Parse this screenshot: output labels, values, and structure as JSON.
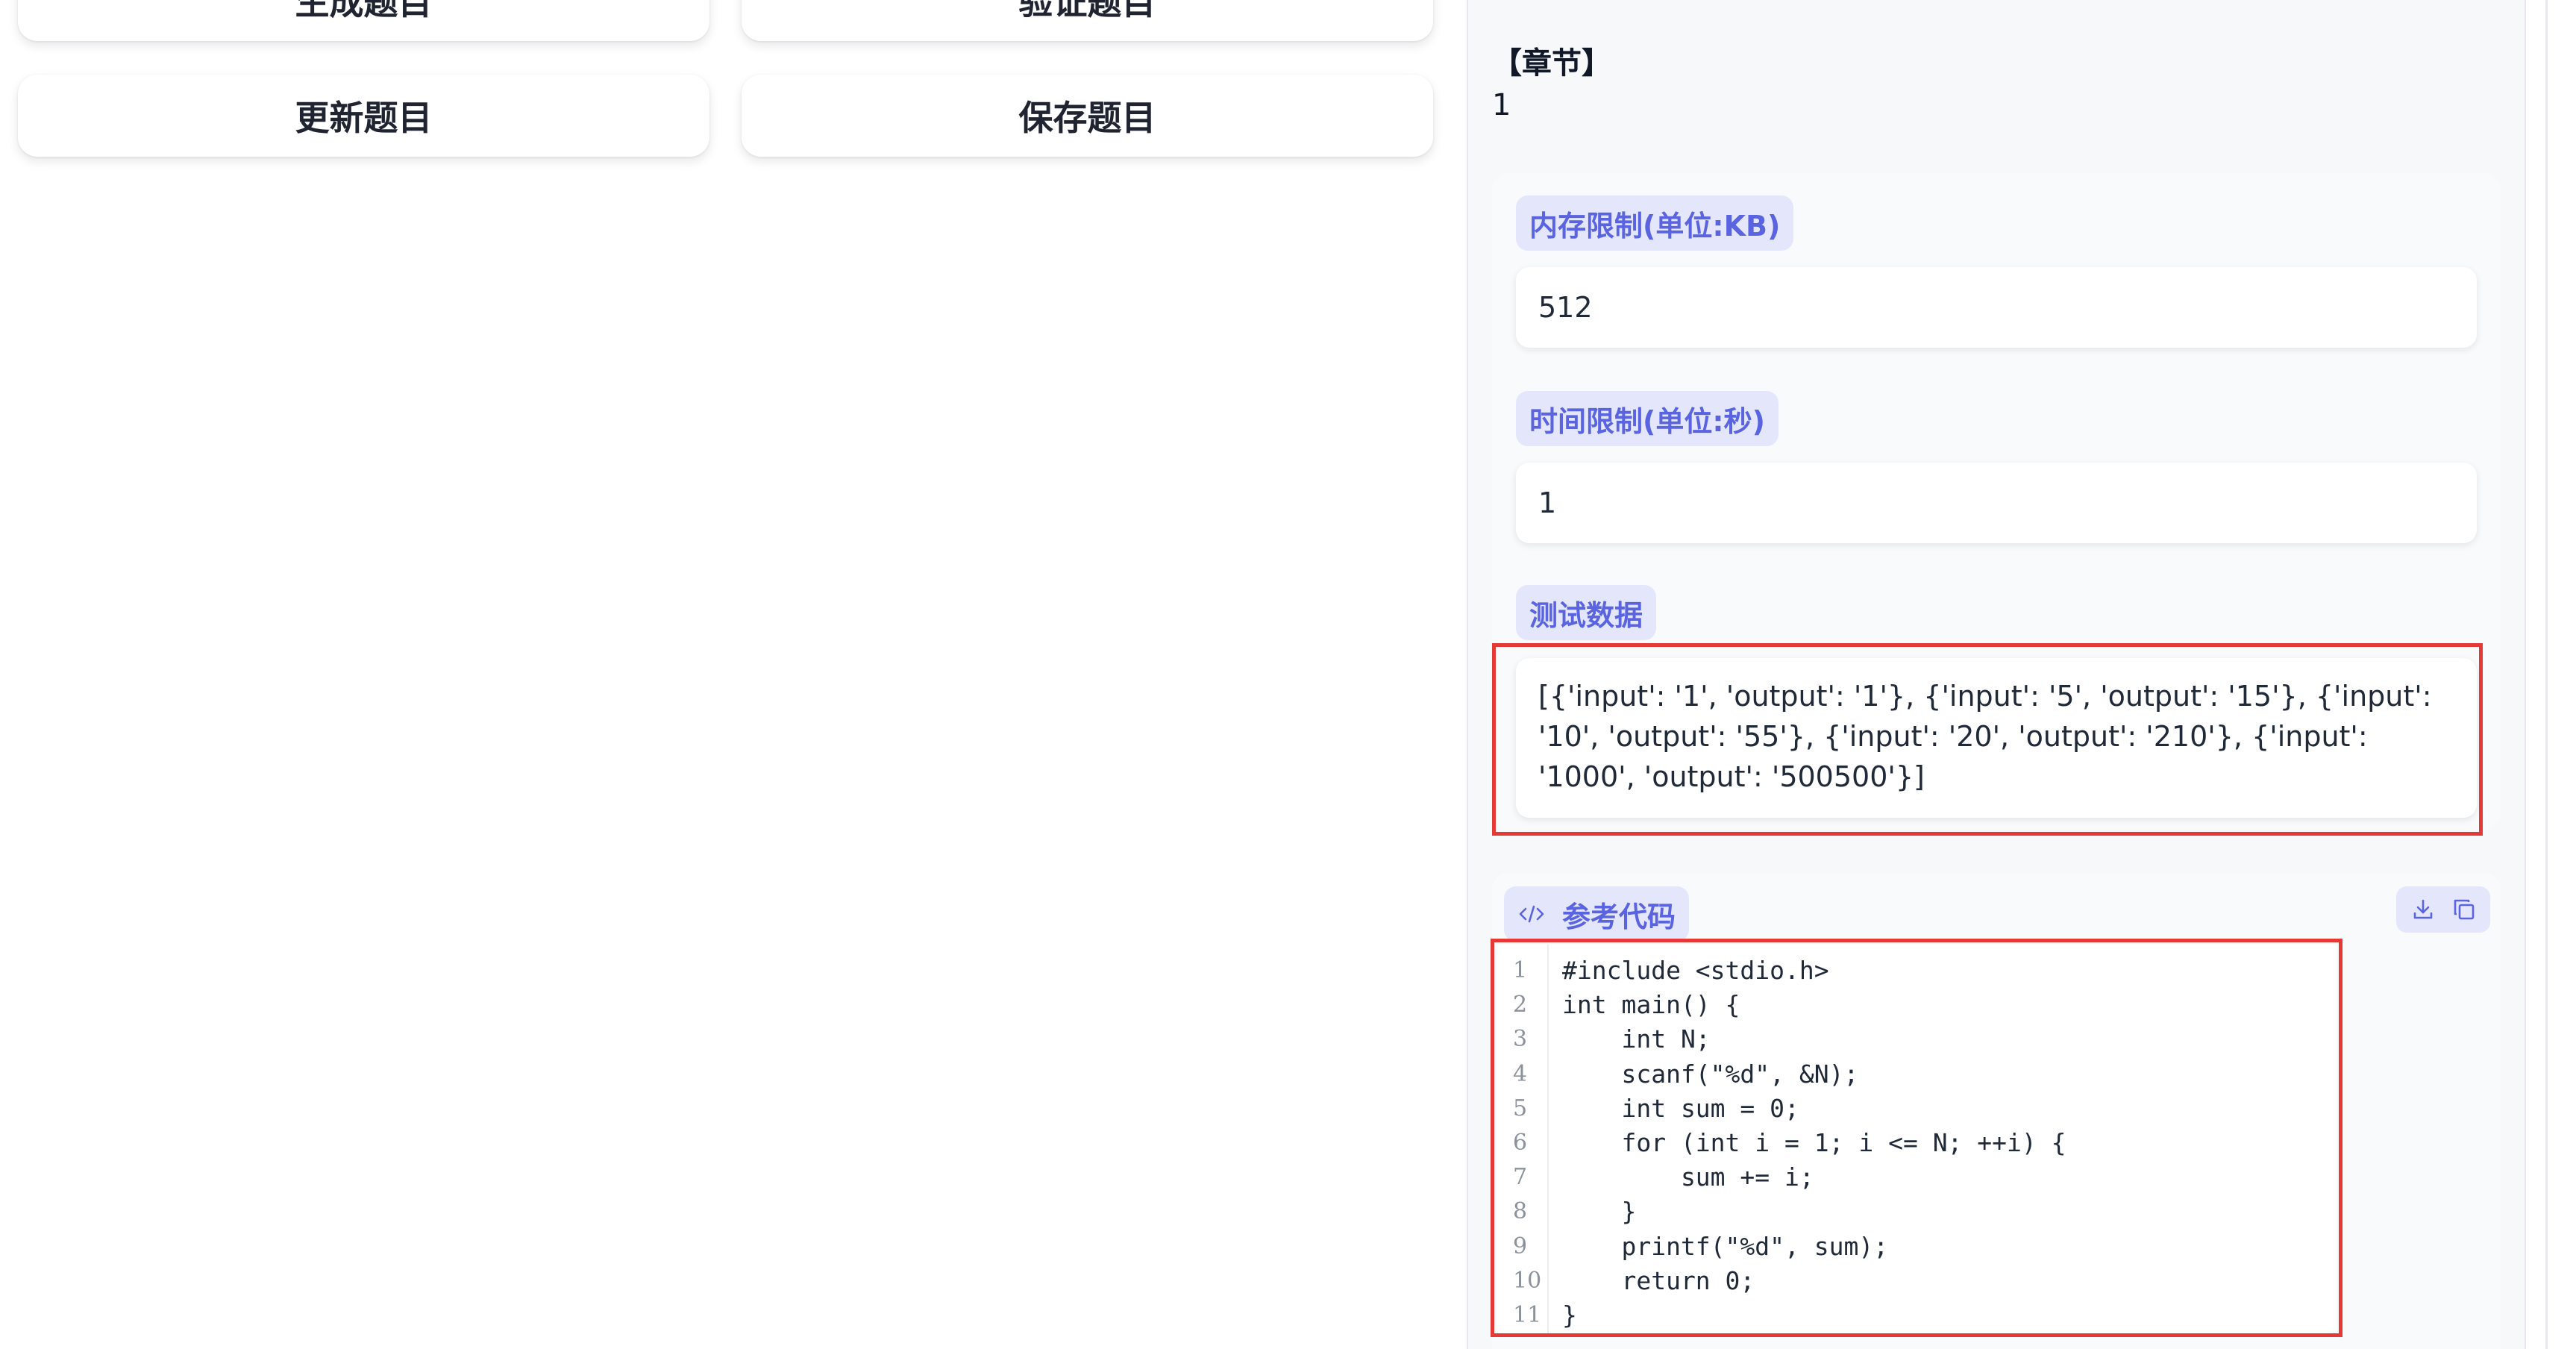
{
  "actions": {
    "generate_label": "生成题目",
    "verify_label": "验证题目",
    "update_label": "更新题目",
    "save_label": "保存题目"
  },
  "chapter": {
    "title": "【章节】",
    "value": "1"
  },
  "memory_limit": {
    "label": "内存限制(单位:KB)",
    "value": "512"
  },
  "time_limit": {
    "label": "时间限制(单位:秒)",
    "value": "1"
  },
  "test_data": {
    "label": "测试数据",
    "value": "[{'input': '1', 'output': '1'}, {'input': '5', 'output': '15'}, {'input': '10', 'output': '55'}, {'input': '20', 'output': '210'}, {'input': '1000', 'output': '500500'}]"
  },
  "reference_code": {
    "label": "参考代码",
    "icon": "code-icon",
    "tools": [
      "download-icon",
      "copy-icon"
    ],
    "lines": [
      "#include <stdio.h>",
      "int main() {",
      "    int N;",
      "    scanf(\"%d\", &N);",
      "    int sum = 0;",
      "    for (int i = 1; i <= N; ++i) {",
      "        sum += i;",
      "    }",
      "    printf(\"%d\", sum);",
      "    return 0;",
      "}"
    ]
  },
  "colors": {
    "accent": "#5b64e0",
    "tag_background": "#e4e7fb",
    "highlight": "#e53935",
    "panel_background": "#f7f8fa"
  }
}
